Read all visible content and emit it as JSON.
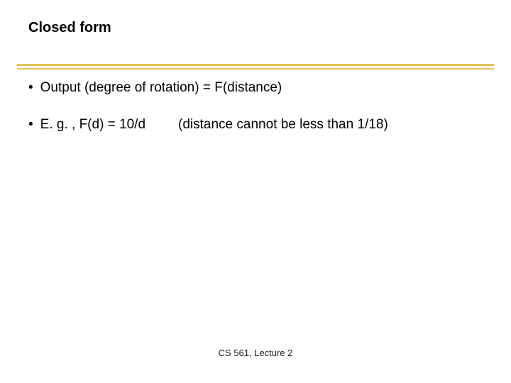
{
  "title": "Closed form",
  "bullets": [
    "Output (degree of rotation) = F(distance)",
    "E. g. , F(d) = 10/d"
  ],
  "bullet2_note": "(distance cannot be less than 1/18)",
  "footer": "CS 561,  Lecture 2",
  "bullet_glyph": "•"
}
